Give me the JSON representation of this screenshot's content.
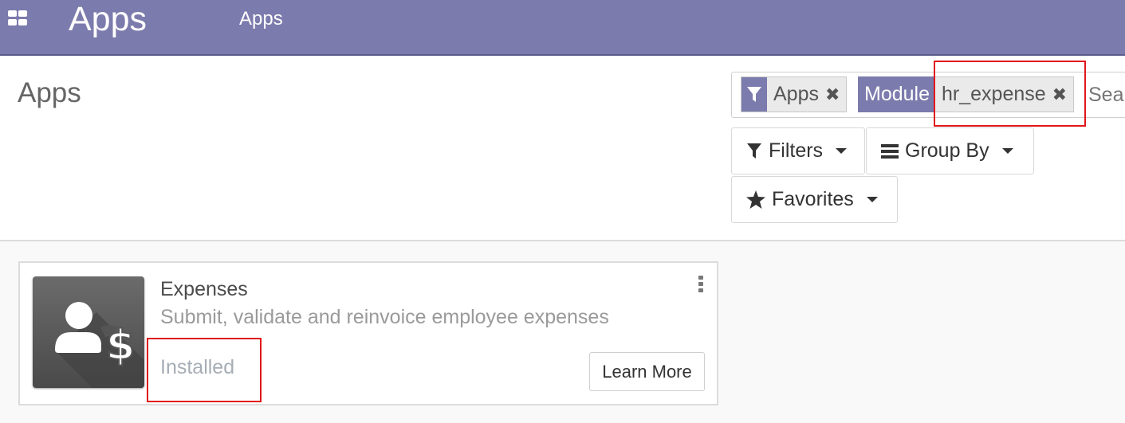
{
  "navbar": {
    "brand": "Apps",
    "menu_item": "Apps"
  },
  "control_panel": {
    "title": "Apps",
    "search": {
      "facets": [
        {
          "label": "",
          "value": "Apps",
          "icon": "filter-icon"
        },
        {
          "label": "Module",
          "value": "hr_expense"
        }
      ],
      "placeholder": "Search..."
    },
    "buttons": {
      "filters": "Filters",
      "group_by": "Group By",
      "favorites": "Favorites"
    }
  },
  "card": {
    "name": "Expenses",
    "summary": "Submit, validate and reinvoice employee expenses",
    "status": "Installed",
    "learn_more": "Learn More",
    "icon": "expenses-app-icon"
  },
  "colors": {
    "navbar": "#7c7bad",
    "highlight": "#e0161b"
  }
}
